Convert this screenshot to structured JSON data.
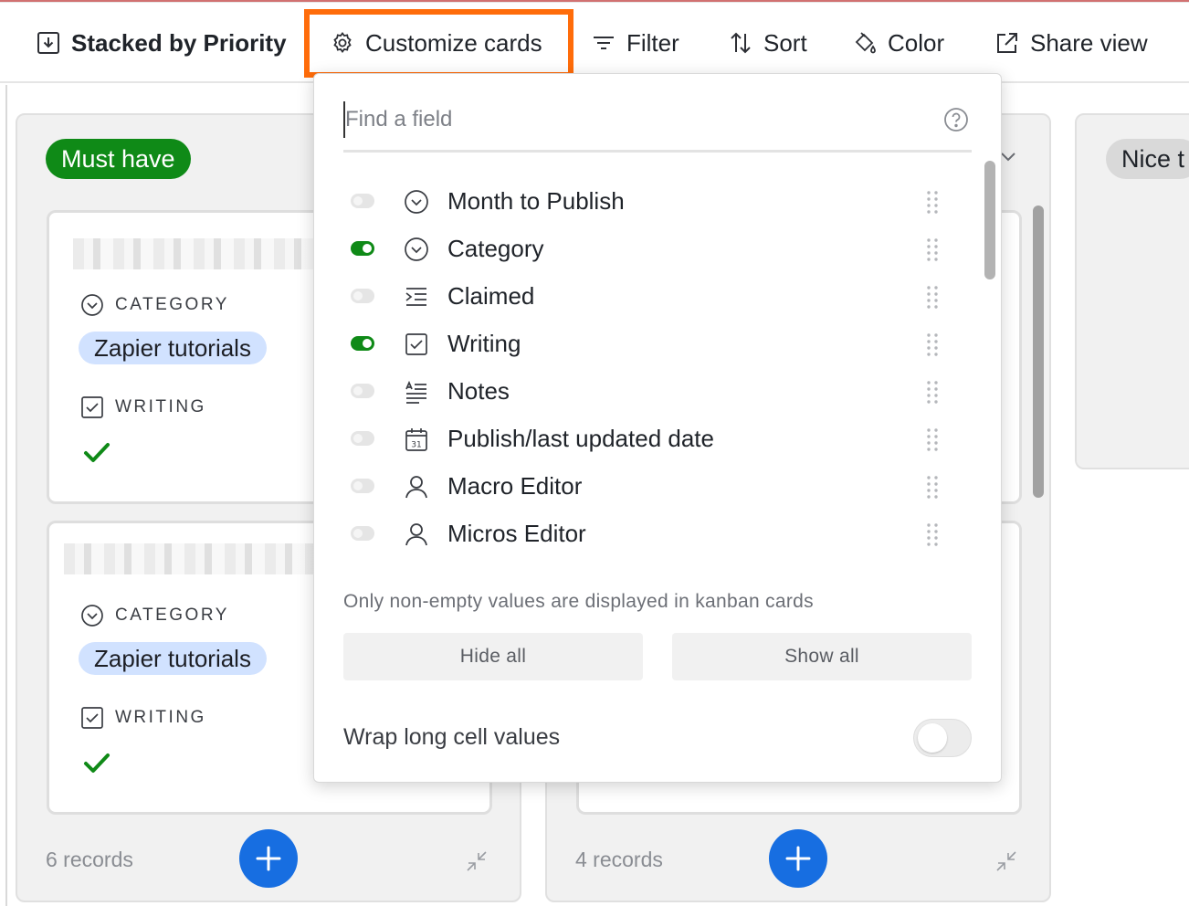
{
  "toolbar": {
    "stacked_label": "Stacked by Priority",
    "customize_label": "Customize cards",
    "filter_label": "Filter",
    "sort_label": "Sort",
    "color_label": "Color",
    "share_label": "Share view"
  },
  "columns": [
    {
      "name": "Must have",
      "cards": [
        {
          "category_label": "CATEGORY",
          "category_value": "Zapier tutorials",
          "writing_label": "WRITING"
        },
        {
          "category_label": "CATEGORY",
          "category_value": "Zapier tutorials",
          "writing_label": "WRITING"
        }
      ],
      "record_count": "6 records"
    },
    {
      "name": "",
      "record_count": "4 records"
    },
    {
      "name": "Nice t"
    }
  ],
  "popover": {
    "search_placeholder": "Find a field",
    "fields": [
      {
        "name": "Month to Publish",
        "icon": "chevron-circle-icon",
        "visible": false
      },
      {
        "name": "Category",
        "icon": "chevron-circle-icon",
        "visible": true
      },
      {
        "name": "Claimed",
        "icon": "indent-list-icon",
        "visible": false
      },
      {
        "name": "Writing",
        "icon": "checkbox-icon",
        "visible": true
      },
      {
        "name": "Notes",
        "icon": "rich-text-icon",
        "visible": false
      },
      {
        "name": "Publish/last updated date",
        "icon": "calendar-icon",
        "visible": false
      },
      {
        "name": "Macro Editor",
        "icon": "user-icon",
        "visible": false
      },
      {
        "name": "Micros Editor",
        "icon": "user-icon",
        "visible": false
      }
    ],
    "calendar_day": "31",
    "hint": "Only non-empty values are displayed in kanban cards",
    "hide_all_label": "Hide all",
    "show_all_label": "Show all",
    "wrap_label": "Wrap long cell values",
    "wrap_enabled": false
  },
  "colors": {
    "accent_orange": "#ff6c0a",
    "green": "#0f8a17",
    "blue": "#176ee1",
    "tag_blue": "#d1e2ff"
  }
}
